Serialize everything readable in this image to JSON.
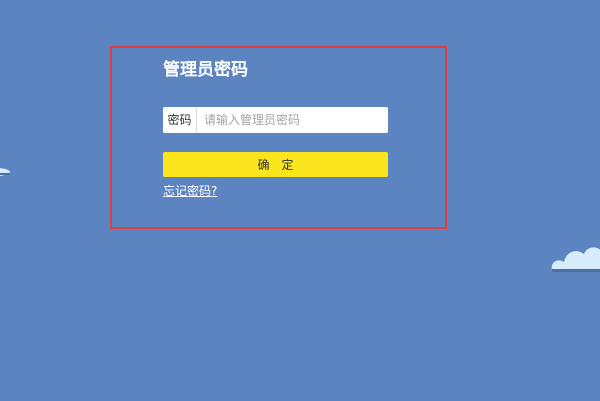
{
  "login": {
    "title": "管理员密码",
    "password_label": "密码",
    "password_value": "",
    "password_placeholder": "请输入管理员密码",
    "confirm_label": "确　定",
    "forgot_link": "忘记密码?"
  },
  "colors": {
    "background": "#5b84c0",
    "highlight_border": "#e0403d",
    "button": "#fbe51c",
    "cloud": "#d6ecfa"
  },
  "icons": {
    "left_cloud": "cloud-icon",
    "right_cloud": "cloud-icon"
  }
}
